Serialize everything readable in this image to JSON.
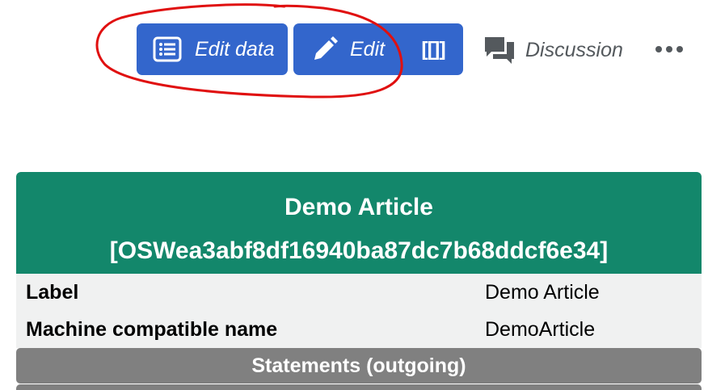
{
  "toolbar": {
    "edit_data_label": "Edit data",
    "edit_label": "Edit",
    "code_label": "[[]]",
    "discussion_label": "Discussion",
    "more_icon": "ellipsis-icon",
    "accent_color": "#3366cc"
  },
  "infobox": {
    "title": "Demo Article",
    "id": "[OSWea3abf8df16940ba87dc7b68ddcf6e34]",
    "header_color": "#13876b",
    "rows": [
      {
        "key": "Label",
        "value": "Demo Article"
      },
      {
        "key": "Machine compatible name",
        "value": "DemoArticle"
      }
    ],
    "section_title": "Statements (outgoing)"
  },
  "annotation": {
    "color": "#e01010",
    "shape": "hand-drawn ellipse"
  }
}
